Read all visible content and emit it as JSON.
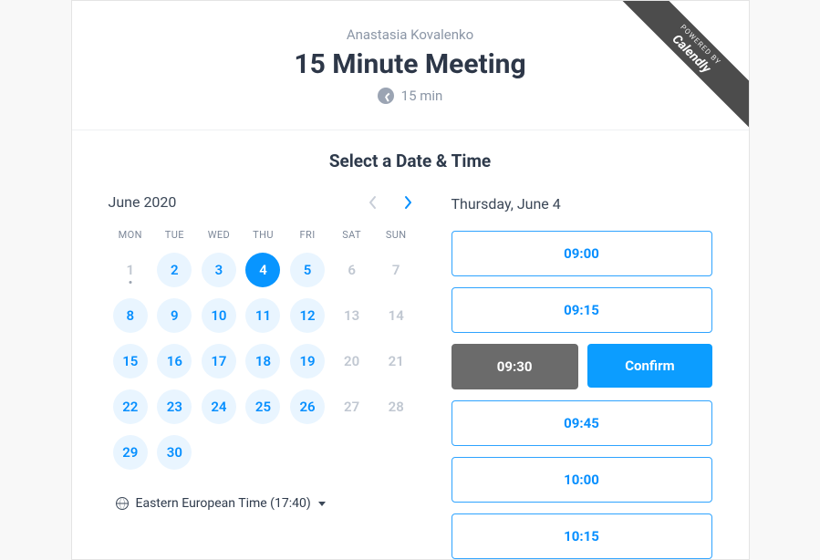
{
  "ribbon": {
    "small": "POWERED BY",
    "big": "Calendly"
  },
  "header": {
    "host_name": "Anastasia Kovalenko",
    "meeting_title": "15 Minute Meeting",
    "duration_text": "15 min"
  },
  "section_title": "Select a Date & Time",
  "calendar": {
    "month_label": "June 2020",
    "dow": [
      "MON",
      "TUE",
      "WED",
      "THU",
      "FRI",
      "SAT",
      "SUN"
    ],
    "weeks": [
      [
        {
          "n": "1",
          "state": "unavailable",
          "today": true
        },
        {
          "n": "2",
          "state": "available"
        },
        {
          "n": "3",
          "state": "available"
        },
        {
          "n": "4",
          "state": "selected"
        },
        {
          "n": "5",
          "state": "available"
        },
        {
          "n": "6",
          "state": "unavailable"
        },
        {
          "n": "7",
          "state": "unavailable"
        }
      ],
      [
        {
          "n": "8",
          "state": "available"
        },
        {
          "n": "9",
          "state": "available"
        },
        {
          "n": "10",
          "state": "available"
        },
        {
          "n": "11",
          "state": "available"
        },
        {
          "n": "12",
          "state": "available"
        },
        {
          "n": "13",
          "state": "unavailable"
        },
        {
          "n": "14",
          "state": "unavailable"
        }
      ],
      [
        {
          "n": "15",
          "state": "available"
        },
        {
          "n": "16",
          "state": "available"
        },
        {
          "n": "17",
          "state": "available"
        },
        {
          "n": "18",
          "state": "available"
        },
        {
          "n": "19",
          "state": "available"
        },
        {
          "n": "20",
          "state": "unavailable"
        },
        {
          "n": "21",
          "state": "unavailable"
        }
      ],
      [
        {
          "n": "22",
          "state": "available"
        },
        {
          "n": "23",
          "state": "available"
        },
        {
          "n": "24",
          "state": "available"
        },
        {
          "n": "25",
          "state": "available"
        },
        {
          "n": "26",
          "state": "available"
        },
        {
          "n": "27",
          "state": "unavailable"
        },
        {
          "n": "28",
          "state": "unavailable"
        }
      ],
      [
        {
          "n": "29",
          "state": "available"
        },
        {
          "n": "30",
          "state": "available"
        },
        {
          "n": "",
          "state": "empty"
        },
        {
          "n": "",
          "state": "empty"
        },
        {
          "n": "",
          "state": "empty"
        },
        {
          "n": "",
          "state": "empty"
        },
        {
          "n": "",
          "state": "empty"
        }
      ]
    ]
  },
  "timezone": {
    "label": "Eastern European Time (17:40)"
  },
  "times": {
    "date_label": "Thursday, June 4",
    "confirm_label": "Confirm",
    "slots": [
      {
        "t": "09:00",
        "state": "normal"
      },
      {
        "t": "09:15",
        "state": "normal"
      },
      {
        "t": "09:30",
        "state": "selected"
      },
      {
        "t": "09:45",
        "state": "normal"
      },
      {
        "t": "10:00",
        "state": "normal"
      },
      {
        "t": "10:15",
        "state": "normal"
      }
    ]
  }
}
